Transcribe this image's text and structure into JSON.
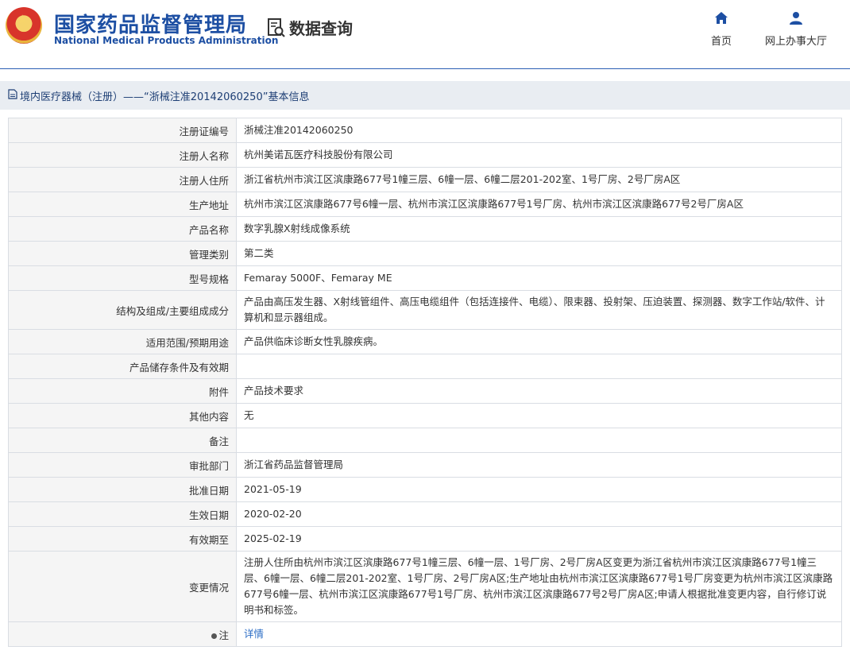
{
  "header": {
    "title_cn": "国家药品监督管理局",
    "title_en": "National Medical Products Administration",
    "query_label": "数据查询"
  },
  "nav": [
    {
      "label": "首页",
      "icon": "home-icon"
    },
    {
      "label": "网上办事大厅",
      "icon": "user-icon"
    }
  ],
  "breadcrumb": {
    "text": "境内医疗器械（注册）——“浙械注准20142060250”基本信息"
  },
  "detail": [
    {
      "label": "注册证编号",
      "value": "浙械注准20142060250"
    },
    {
      "label": "注册人名称",
      "value": "杭州美诺瓦医疗科技股份有限公司"
    },
    {
      "label": "注册人住所",
      "value": "浙江省杭州市滨江区滨康路677号1幢三层、6幢一层、6幢二层201-202室、1号厂房、2号厂房A区"
    },
    {
      "label": "生产地址",
      "value": "杭州市滨江区滨康路677号6幢一层、杭州市滨江区滨康路677号1号厂房、杭州市滨江区滨康路677号2号厂房A区"
    },
    {
      "label": "产品名称",
      "value": "数字乳腺X射线成像系统"
    },
    {
      "label": "管理类别",
      "value": "第二类"
    },
    {
      "label": "型号规格",
      "value": "Femaray 5000F、Femaray ME"
    },
    {
      "label": "结构及组成/主要组成成分",
      "value": "产品由高压发生器、X射线管组件、高压电缆组件（包括连接件、电缆）、限束器、投射架、压迫装置、探测器、数字工作站/软件、计算机和显示器组成。"
    },
    {
      "label": "适用范围/预期用途",
      "value": "产品供临床诊断女性乳腺疾病。"
    },
    {
      "label": "产品储存条件及有效期",
      "value": ""
    },
    {
      "label": "附件",
      "value": "产品技术要求"
    },
    {
      "label": "其他内容",
      "value": "无"
    },
    {
      "label": "备注",
      "value": ""
    },
    {
      "label": "审批部门",
      "value": "浙江省药品监督管理局"
    },
    {
      "label": "批准日期",
      "value": "2021-05-19"
    },
    {
      "label": "生效日期",
      "value": "2020-02-20"
    },
    {
      "label": "有效期至",
      "value": "2025-02-19"
    },
    {
      "label": "变更情况",
      "value": "注册人住所由杭州市滨江区滨康路677号1幢三层、6幢一层、1号厂房、2号厂房A区变更为浙江省杭州市滨江区滨康路677号1幢三层、6幢一层、6幢二层201-202室、1号厂房、2号厂房A区;生产地址由杭州市滨江区滨康路677号1号厂房变更为杭州市滨江区滨康路677号6幢一层、杭州市滨江区滨康路677号1号厂房、杭州市滨江区滨康路677号2号厂房A区;申请人根据批准变更内容，自行修订说明书和标签。"
    }
  ],
  "note": {
    "label": "注",
    "link": "详情"
  },
  "colors": {
    "brand": "#1d4fa3",
    "link": "#2b6dc5",
    "label_bg": "#f5f5f5",
    "bar_bg": "#e9edf2"
  }
}
